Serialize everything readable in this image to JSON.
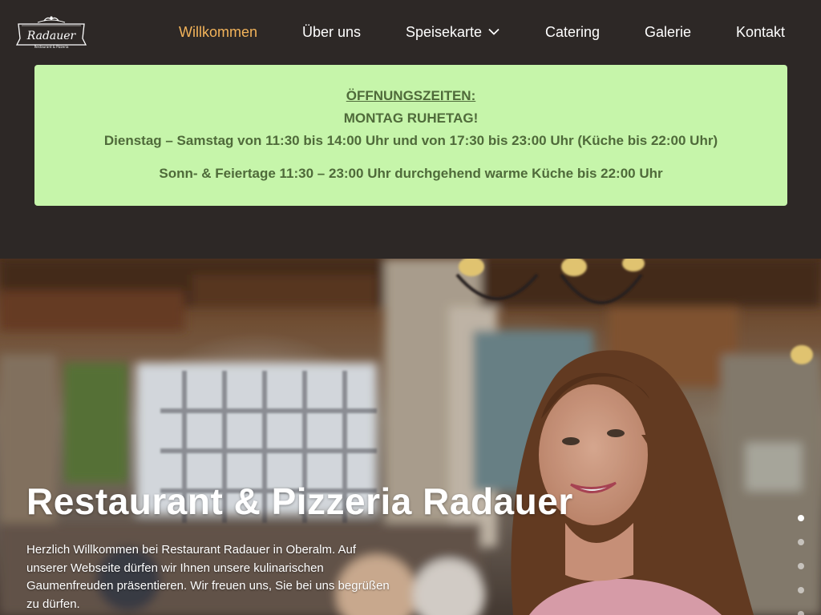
{
  "brand": {
    "logo_text": "Radauer",
    "logo_subtext": "Restaurant & Pizzeria"
  },
  "nav": {
    "items": [
      {
        "label": "Willkommen",
        "active": true
      },
      {
        "label": "Über uns"
      },
      {
        "label": "Speisekarte",
        "has_dropdown": true
      },
      {
        "label": "Catering"
      },
      {
        "label": "Galerie"
      },
      {
        "label": "Kontakt"
      }
    ],
    "active_color": "#f2b35a",
    "text_color": "#ffffff"
  },
  "hours": {
    "heading": "ÖFFNUNGSZEITEN:",
    "closed_note": "MONTAG RUHETAG!",
    "weekdays": "Dienstag – Samstag von 11:30 bis 14:00 Uhr und von 17:30 bis 23:00 Uhr (Küche bis 22:00 Uhr)",
    "holidays": "Sonn- & Feiertage 11:30 – 23:00 Uhr durchgehend warme Küche bis 22:00 Uhr",
    "background_color": "#c6f5aa",
    "text_color": "#4f6a3a"
  },
  "hero": {
    "title": "Restaurant & Pizzeria Radauer",
    "text": "Herzlich Willkommen bei Restaurant Radauer in Oberalm. Auf unserer Webseite dürfen wir Ihnen unsere kulinarischen Gaumenfreuden präsentieren. Wir freuen uns, Sie bei uns begrüßen zu dürfen.",
    "slide_count": 5,
    "active_slide": 1
  },
  "colors": {
    "page_background": "#2d2826"
  }
}
